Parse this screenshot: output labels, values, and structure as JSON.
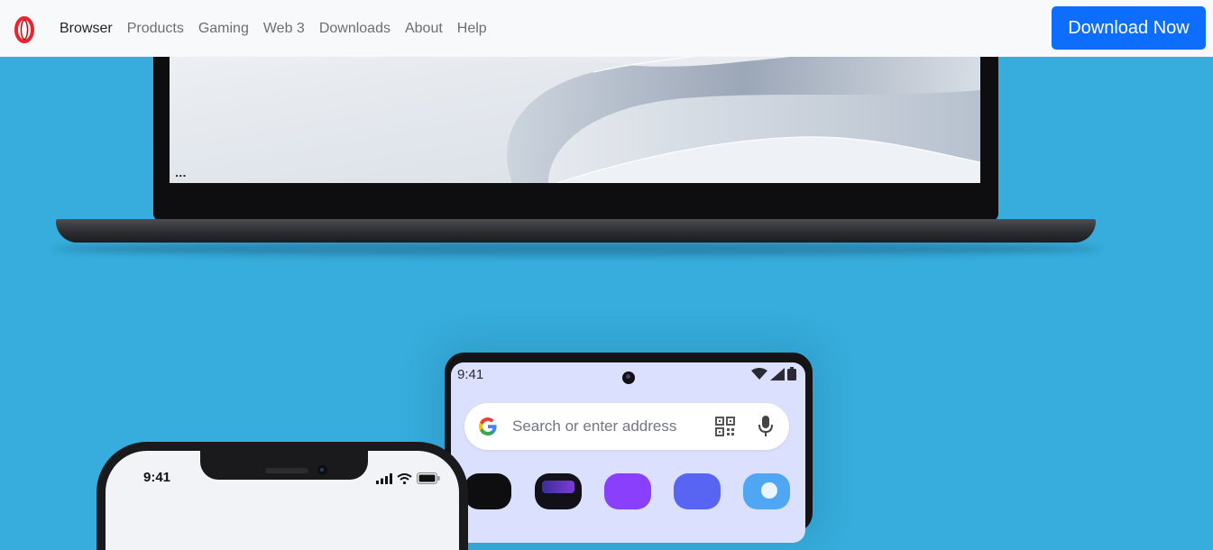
{
  "navbar": {
    "logo_name": "opera-logo",
    "links": [
      {
        "label": "Browser",
        "active": true
      },
      {
        "label": "Products",
        "active": false
      },
      {
        "label": "Gaming",
        "active": false
      },
      {
        "label": "Web 3",
        "active": false
      },
      {
        "label": "Downloads",
        "active": false
      },
      {
        "label": "About",
        "active": false
      },
      {
        "label": "Help",
        "active": false
      }
    ],
    "cta_label": "Download Now"
  },
  "laptop": {
    "screen_indicator": "..."
  },
  "android_phone": {
    "status_time": "9:41",
    "status_icons": [
      "wifi-icon",
      "signal-icon",
      "battery-icon"
    ],
    "search_placeholder": "Search or enter address",
    "search_icons": [
      "google-icon",
      "qr-code-icon",
      "microphone-icon"
    ],
    "app_icons": [
      "app-icon-dark",
      "app-icon-dark-purple",
      "app-icon-purple",
      "app-icon-indigo",
      "app-icon-blue"
    ]
  },
  "iphone": {
    "status_time": "9:41",
    "status_icons": [
      "signal-icon",
      "wifi-icon",
      "battery-icon"
    ]
  },
  "colors": {
    "background": "#36ADDC",
    "navbar_bg": "#F8F9FA",
    "cta_bg": "#0D6EFD",
    "logo_red": "#E8242F",
    "android_screen": "#DCE0FF"
  }
}
